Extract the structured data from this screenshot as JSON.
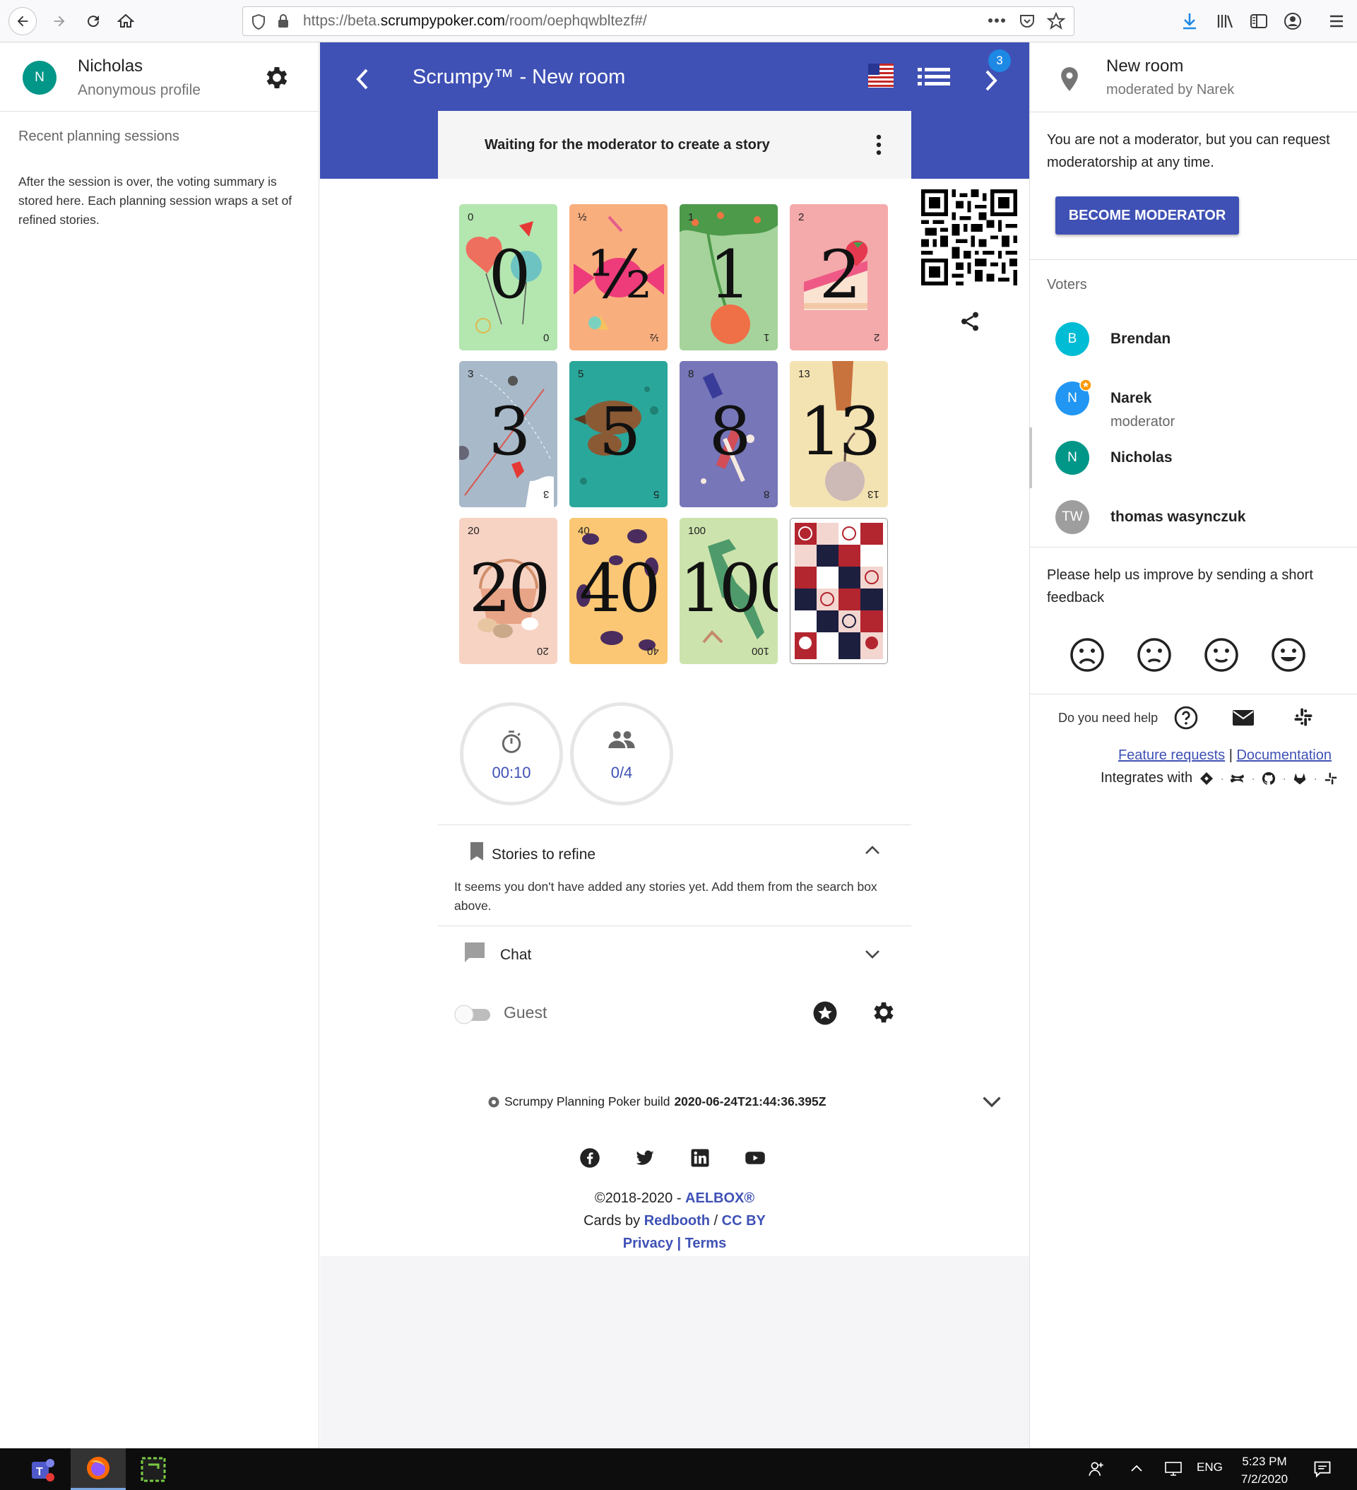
{
  "browser": {
    "url_prefix": "https://beta.",
    "url_host": "scrumpypoker.com",
    "url_path": "/room/oephqwbltezf#/"
  },
  "left": {
    "avatar_initial": "N",
    "user_name": "Nicholas",
    "user_subtitle": "Anonymous profile",
    "recent_title": "Recent planning sessions",
    "recent_desc": "After the session is over, the voting summary is stored here. Each planning session wraps a set of refined stories."
  },
  "header": {
    "title": "Scrumpy™ - New room",
    "badge_count": "3",
    "story_status": "Waiting for the moderator to create a story"
  },
  "cards": [
    {
      "value": "0",
      "corner": "0",
      "bg": "#b4e6b0"
    },
    {
      "value": "½",
      "corner": "½",
      "bg": "#f9ae7e"
    },
    {
      "value": "1",
      "corner": "1",
      "bg": "#a6d39c"
    },
    {
      "value": "2",
      "corner": "2",
      "bg": "#f4a9ab"
    },
    {
      "value": "3",
      "corner": "3",
      "bg": "#a8b9c9"
    },
    {
      "value": "5",
      "corner": "5",
      "bg": "#2aa79b"
    },
    {
      "value": "8",
      "corner": "8",
      "bg": "#7676b8"
    },
    {
      "value": "13",
      "corner": "13",
      "bg": "#f4e3b2"
    },
    {
      "value": "20",
      "corner": "20",
      "bg": "#f7d3c4"
    },
    {
      "value": "40",
      "corner": "40",
      "bg": "#fbc774"
    },
    {
      "value": "100",
      "corner": "100",
      "bg": "#cde3ad"
    }
  ],
  "stats": {
    "timer": "00:10",
    "votes": "0/4"
  },
  "stories": {
    "title": "Stories to refine",
    "empty_text": "It seems you don't have added any stories yet. Add them from the search box above."
  },
  "chat": {
    "title": "Chat"
  },
  "guest": {
    "label": "Guest"
  },
  "build": {
    "prefix": "Scrumpy Planning Poker build",
    "version": "2020-06-24T21:44:36.395Z"
  },
  "footer": {
    "copyright": "©2018-2020 - ",
    "company": "AELBOX®",
    "cards_by": "Cards by ",
    "redbooth": "Redbooth",
    "sep": " / ",
    "license": "CC BY",
    "privacy": "Privacy",
    "pipe": " | ",
    "terms": "Terms"
  },
  "right": {
    "room_name": "New room",
    "moderated_by": "moderated by Narek",
    "mod_text": "You are not a moderator, but you can request moderatorship at any time.",
    "become_button": "BECOME MODERATOR",
    "voters_title": "Voters",
    "voters": [
      {
        "initial": "B",
        "name": "Brendan",
        "role": "",
        "color": "#00bcd4"
      },
      {
        "initial": "N",
        "name": "Narek",
        "role": "moderator",
        "color": "#2196f3"
      },
      {
        "initial": "N",
        "name": "Nicholas",
        "role": "",
        "color": "#009688"
      },
      {
        "initial": "TW",
        "name": "thomas wasynczuk",
        "role": "",
        "color": "#9e9e9e"
      }
    ],
    "feedback_text": "Please help us improve by sending a short feedback",
    "help_label": "Do you need help",
    "feature_requests": "Feature requests",
    "links_sep": " | ",
    "documentation": "Documentation",
    "integrates": "Integrates with"
  },
  "taskbar": {
    "lang": "ENG",
    "time": "5:23 PM",
    "date": "7/2/2020"
  },
  "colors": {
    "primary": "#3f51b5",
    "badge": "#1e88e5"
  }
}
